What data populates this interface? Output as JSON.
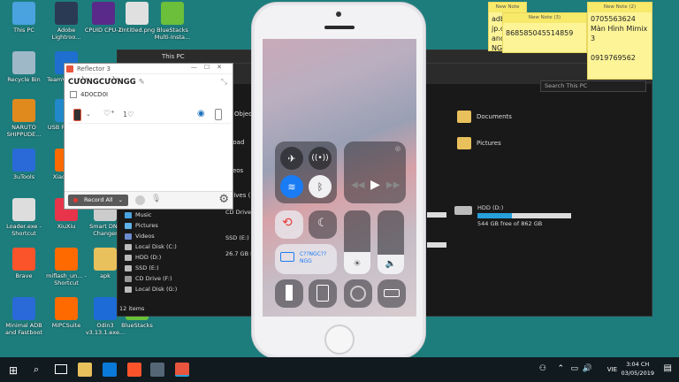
{
  "desktop_icons": [
    {
      "label": "This PC",
      "icon": "computer-icon",
      "color": "#4aa3df"
    },
    {
      "label": "Adobe Lightroo...",
      "icon": "lightroom-icon",
      "color": "#2a3a55"
    },
    {
      "label": "CPUID CPU-Z",
      "icon": "cpuz-icon",
      "color": "#5a2a8a"
    },
    {
      "label": "Untitled.png",
      "icon": "image-file-icon",
      "color": "#e0e0e0"
    },
    {
      "label": "BlueStacks Multi-Insta...",
      "icon": "bluestacks-icon",
      "color": "#6bbf3a"
    },
    {
      "label": "Recycle Bin",
      "icon": "recycle-bin-icon",
      "color": "#9fb8c8"
    },
    {
      "label": "TeamVie... 14",
      "icon": "teamviewer-icon",
      "color": "#1e6fd0"
    },
    {
      "label": "NARUTO SHIPPUDE...",
      "icon": "naruto-icon",
      "color": "#e08a1e"
    },
    {
      "label": "USB Redirect",
      "icon": "usb-icon",
      "color": "#2288cc"
    },
    {
      "label": "3uTools",
      "icon": "3utools-icon",
      "color": "#2a6ad8"
    },
    {
      "label": "XiaoMiF...",
      "icon": "xiaomi-icon",
      "color": "#ff6a00"
    },
    {
      "label": "Loader.exe - Shortcut",
      "icon": "loader-icon",
      "color": "#ddd"
    },
    {
      "label": "XiuXiu",
      "icon": "xiuxiu-icon",
      "color": "#e8344a"
    },
    {
      "label": "Smart DNS Changer",
      "icon": "dns-icon",
      "color": "#ccc"
    },
    {
      "label": "Brave",
      "icon": "brave-icon",
      "color": "#fb542b"
    },
    {
      "label": "miflash_un... - Shortcut",
      "icon": "miflash-icon",
      "color": "#ff6a00"
    },
    {
      "label": "apk",
      "icon": "folder-icon",
      "color": "#e8c05c"
    },
    {
      "label": "Minimal ADB and Fastboot",
      "icon": "adb-icon",
      "color": "#2a6ad8"
    },
    {
      "label": "MiPCSuite",
      "icon": "mipcsuite-icon",
      "color": "#ff6a00"
    },
    {
      "label": "Odin3 v3.13.1.exe...",
      "icon": "odin-icon",
      "color": "#1c6bd6"
    },
    {
      "label": "BlueStacks",
      "icon": "bluestacks-icon",
      "color": "#6bbf3a"
    }
  ],
  "explorer": {
    "title": "This PC",
    "search_placeholder": "Search This PC",
    "partial_labels": {
      "objects": "Object",
      "downloads": "nload",
      "videos": "leos",
      "drives": "drives (",
      "cd": "CD Drive (",
      "ssd": "SSD (E:)",
      "ssd_free": "26.7 GB fre"
    },
    "folders": [
      {
        "name": "Documents"
      },
      {
        "name": "Pictures"
      }
    ],
    "drives": [
      {
        "name": "HDD (D:)",
        "free": "544 GB free of 862 GB",
        "used_fraction": 0.37
      }
    ],
    "nav": [
      "Music",
      "Pictures",
      "Videos",
      "Local Disk (C:)",
      "HDD (D:)",
      "SSD (E:)",
      "CD Drive (F:)",
      "Local Disk (G:)"
    ],
    "status": "12 items"
  },
  "reflector": {
    "title": "Reflector 3",
    "device_name": "CƯỜNGCƯỜNGG",
    "code": "4D0CD0I",
    "likes": "1",
    "record_label": "Record All"
  },
  "notes": [
    {
      "header": "New Note",
      "lines": [
        "adb",
        "jp.c",
        "and",
        "NGI"
      ]
    },
    {
      "header": "New Note (3)",
      "lines": [
        "868585045514859"
      ]
    },
    {
      "header": "New Note (2)",
      "lines": [
        "0705563624",
        "Màn Hình Mimix 3",
        "",
        "0919769562"
      ]
    }
  ],
  "control_center": {
    "mirror_label": "C??NGC?? NGG",
    "brightness_level": 0.35,
    "volume_level": 0.3
  },
  "taskbar": {
    "time": "3:04 CH",
    "date": "03/05/2019",
    "lang": "VIE"
  },
  "colors": {
    "desktop": "#1d7d7d",
    "accent": "#26a0da",
    "note": "#fdf498"
  }
}
